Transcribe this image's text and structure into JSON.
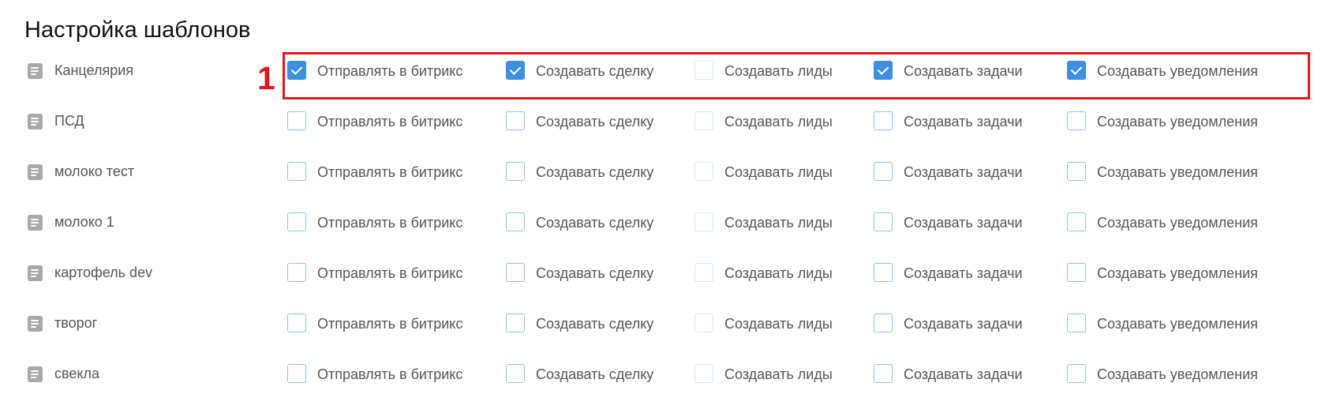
{
  "page": {
    "title": "Настройка шаблонов"
  },
  "options": [
    {
      "key": "bitrix",
      "label": "Отправлять в битрикс"
    },
    {
      "key": "deal",
      "label": "Создавать сделку"
    },
    {
      "key": "leads",
      "label": "Создавать лиды"
    },
    {
      "key": "tasks",
      "label": "Создавать задачи"
    },
    {
      "key": "notifications",
      "label": "Создавать уведомления"
    }
  ],
  "templates": [
    {
      "name": "Канцелярия",
      "icon": "document-icon",
      "checked": [
        true,
        true,
        false,
        true,
        true
      ]
    },
    {
      "name": "ПСД",
      "icon": "document-icon",
      "checked": [
        false,
        false,
        false,
        false,
        false
      ]
    },
    {
      "name": "молоко тест",
      "icon": "document-icon",
      "checked": [
        false,
        false,
        false,
        false,
        false
      ]
    },
    {
      "name": "молоко 1",
      "icon": "document-icon",
      "checked": [
        false,
        false,
        false,
        false,
        false
      ]
    },
    {
      "name": "картофель dev",
      "icon": "document-icon",
      "checked": [
        false,
        false,
        false,
        false,
        false
      ]
    },
    {
      "name": "творог",
      "icon": "document-icon",
      "checked": [
        false,
        false,
        false,
        false,
        false
      ]
    },
    {
      "name": "свекла",
      "icon": "document-icon",
      "checked": [
        false,
        false,
        false,
        false,
        false
      ]
    }
  ],
  "annotation": {
    "marker": "1",
    "color": "#e3141b"
  },
  "colors": {
    "checkbox_checked": "#3d8fe0",
    "checkbox_border": "#8fc2ee",
    "text": "#555555"
  }
}
